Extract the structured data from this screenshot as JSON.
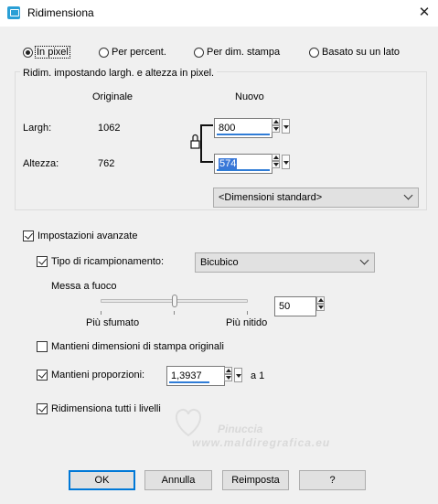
{
  "window": {
    "title": "Ridimensiona"
  },
  "mode": {
    "options": [
      "In pixel",
      "Per percent.",
      "Per dim. stampa",
      "Basato su un lato"
    ],
    "selected": "In pixel"
  },
  "pixel_group": {
    "caption": "Ridim. impostando largh. e altezza in pixel.",
    "col_original": "Originale",
    "col_new": "Nuovo",
    "width_label": "Largh:",
    "width_original": "1062",
    "width_new": "800",
    "height_label": "Altezza:",
    "height_original": "762",
    "height_new": "574",
    "standard_sizes": "<Dimensioni standard>"
  },
  "advanced": {
    "label": "Impostazioni avanzate",
    "checked": true,
    "resample_label": "Tipo di ricampionamento:",
    "resample_checked": true,
    "resample_value": "Bicubico",
    "sharpen_label": "Messa a fuoco",
    "sharpen_value": "50",
    "sharpen_fraction": 0.5,
    "slider_left": "Più sfumato",
    "slider_right": "Più nitido",
    "keep_print_label": "Mantieni dimensioni di stampa originali",
    "keep_print_checked": false,
    "keep_ratio_label": "Mantieni proporzioni:",
    "keep_ratio_checked": true,
    "ratio_value": "1,3937",
    "ratio_suffix": "a 1",
    "resize_layers_label": "Ridimensiona tutti i livelli",
    "resize_layers_checked": true
  },
  "watermark": {
    "name": "Pinuccia",
    "url": "www.maldiregrafica.eu"
  },
  "buttons": {
    "ok": "OK",
    "cancel": "Annulla",
    "reset": "Reimposta",
    "help": "?"
  }
}
